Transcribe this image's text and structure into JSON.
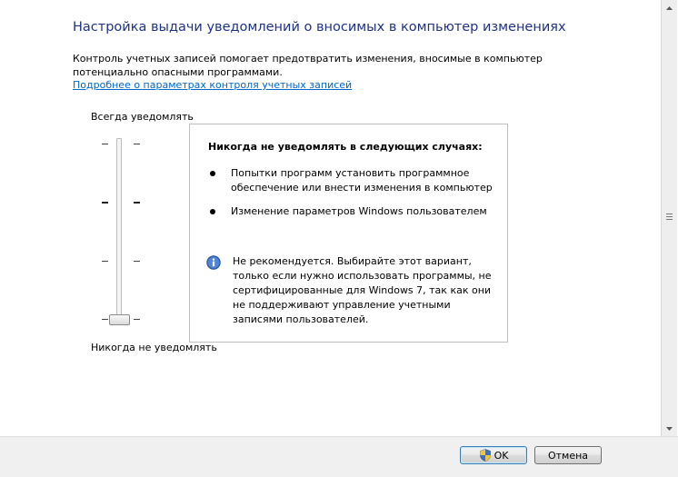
{
  "title": "Настройка выдачи уведомлений о вносимых в компьютер изменениях",
  "description": "Контроль учетных записей помогает предотвратить изменения, вносимые в компьютер потенциально опасными программами.",
  "learn_more_link": "Подробнее о параметрах контроля учетных записей",
  "slider": {
    "top_label": "Всегда уведомлять",
    "bottom_label": "Никогда не уведомлять",
    "levels": 4,
    "selected_level": 1
  },
  "infobox": {
    "heading": "Никогда не уведомлять в следующих случаях:",
    "bullets": [
      "Попытки программ установить программное обеспечение или внести изменения в компьютер",
      "Изменение параметров Windows пользователем"
    ],
    "note": "Не рекомендуется. Выбирайте этот вариант, только если нужно использовать программы, не сертифицированные для Windows 7, так как они не поддерживают управление учетными записями пользователей."
  },
  "buttons": {
    "ok": "OK",
    "cancel": "Отмена"
  },
  "icons": {
    "info": "info-icon",
    "ok_button": "uac-shield-icon"
  },
  "colors": {
    "title": "#1e3287",
    "link": "#0066cc",
    "info_icon": "#3a6fc4"
  }
}
